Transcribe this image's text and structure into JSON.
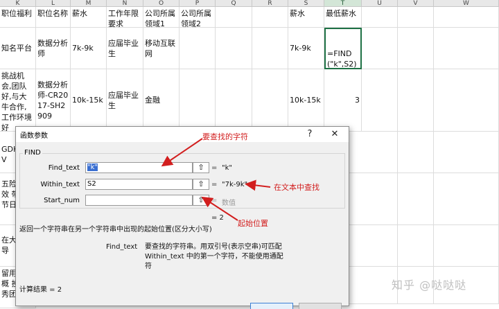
{
  "columns": [
    "K",
    "L",
    "M",
    "N",
    "O",
    "P",
    "Q",
    "R",
    "S",
    "T",
    "U",
    "V",
    "W"
  ],
  "rows": {
    "header": [
      "职位福利",
      "职位名称",
      "薪水",
      "工作年限要求",
      "公司所属领域1",
      "公司所属领域2",
      "",
      "",
      "薪水",
      "最低薪水"
    ],
    "row1": [
      "知名平台",
      "数据分析师",
      "7k-9k",
      "应届毕业生",
      "移动互联网",
      "",
      "",
      "",
      "7k-9k",
      "=FIND(\"k\",S2)"
    ],
    "row2": [
      "挑战机会,团队好,与大牛合作,工作环境好",
      "数据分析师-CR2017-SH2909",
      "10k-15k",
      "应届毕业生",
      "金融",
      "",
      "",
      "",
      "10k-15k",
      "3"
    ],
    "row3": "GDH BCV",
    "row4": "五险 绩效 带薪 节日",
    "row5": "在大 指导",
    "row6": "留用 会,概 投行 秀团"
  },
  "dialog": {
    "title": "函数参数",
    "help": "?",
    "close": "✕",
    "function_name": "FIND",
    "args": [
      {
        "label": "Find_text",
        "value": "\"k\"",
        "result": "\"k\""
      },
      {
        "label": "Within_text",
        "value": "S2",
        "result": "\"7k-9k\""
      },
      {
        "label": "Start_num",
        "value": "",
        "result": "数值"
      }
    ],
    "formula_result": "= 2",
    "description": "返回一个字符串在另一个字符串中出现的起始位置(区分大小写)",
    "arg_help_name": "Find_text",
    "arg_help_text": "要查找的字符串。用双引号(表示空串)可匹配 Within_text 中的第一个字符，不能使用通配符",
    "calc_result": "计算结果 =   2"
  },
  "annotations": {
    "find_text": "要查找的字符",
    "within_text": "在文本中查找",
    "start_num": "起始位置"
  },
  "watermark": "知乎 @哒哒哒",
  "colors": {
    "annotation": "#d21e1e",
    "selection": "#1e7145",
    "highlight": "#3a6fd1"
  }
}
